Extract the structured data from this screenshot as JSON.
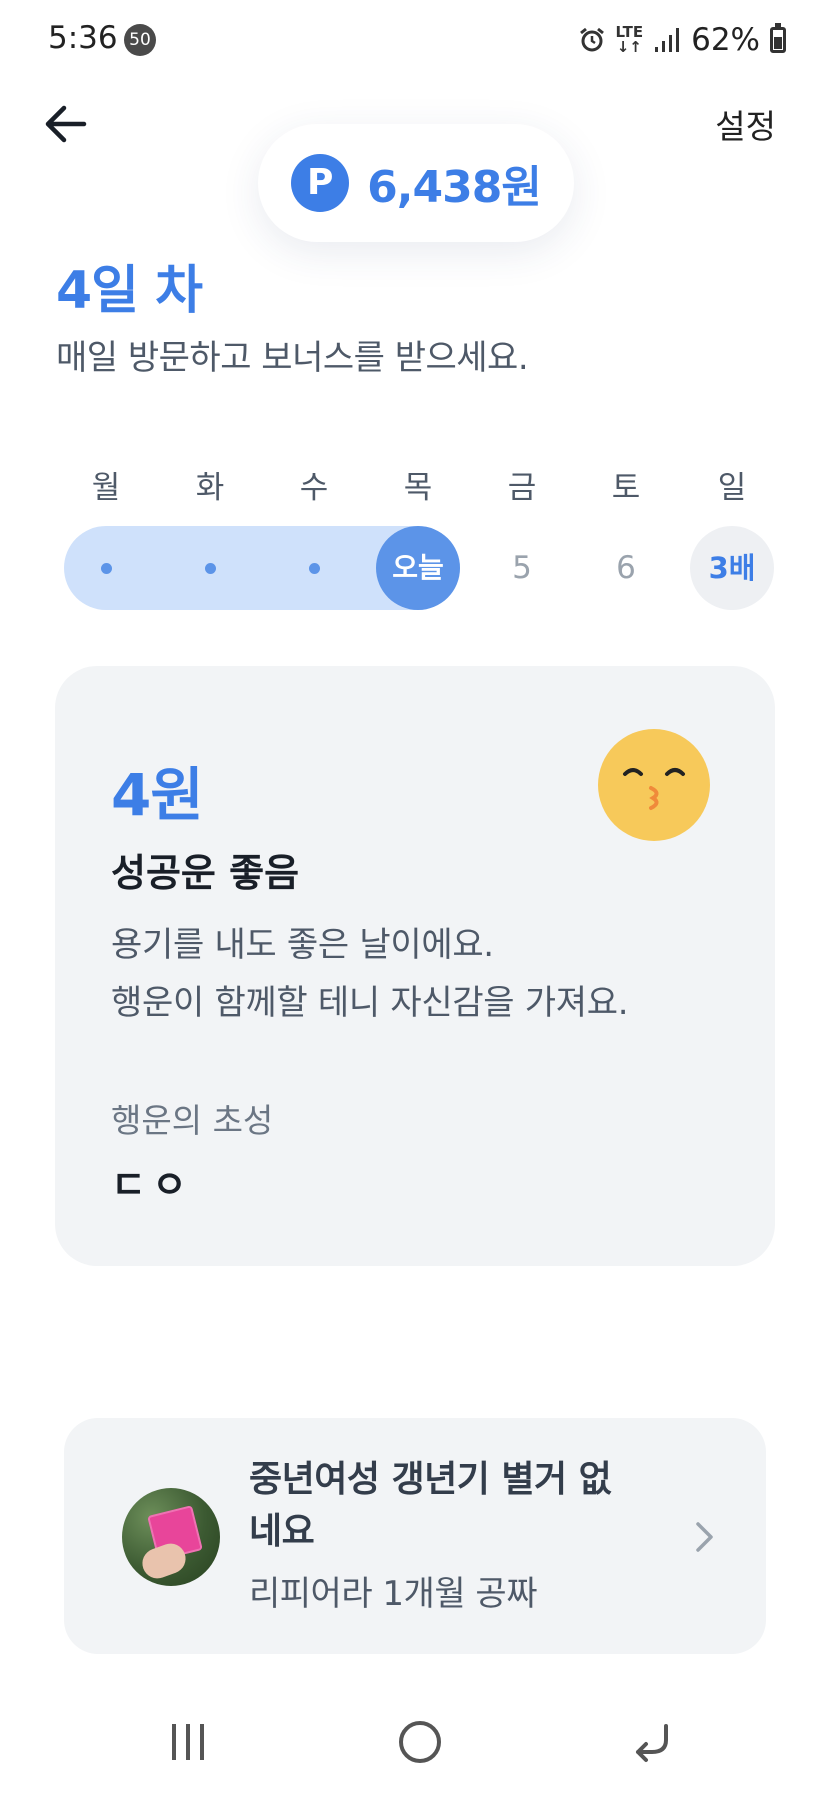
{
  "status_bar": {
    "time": "5:36",
    "notification_badge": "50",
    "network": "LTE",
    "battery": "62%"
  },
  "header": {
    "settings_label": "설정",
    "point_icon_letter": "P",
    "point_amount": "6,438원"
  },
  "attendance": {
    "day_title": "4일 차",
    "subtitle": "매일 방문하고 보너스를 받으세요.",
    "weekdays": [
      "월",
      "화",
      "수",
      "목",
      "금",
      "토",
      "일"
    ],
    "completed_days": 3,
    "today_label": "오늘",
    "future_days": [
      "5",
      "6"
    ],
    "bonus_label": "3배"
  },
  "fortune": {
    "amount": "4원",
    "title": "성공운 좋음",
    "description": [
      "용기를 내도 좋은 날이에요.",
      "행운이 함께할 테니 자신감을 가져요."
    ],
    "initials_label": "행운의 초성",
    "initials_value": "ㄷㅇ",
    "emoji": "kissing-face-icon"
  },
  "ad": {
    "title": "중년여성 갱년기 별거 없네요",
    "subtitle": "리피어라 1개월 공짜"
  },
  "colors": {
    "accent": "#3d7ee6",
    "progress_track": "#cfe1fb",
    "card_bg": "#f2f4f6"
  }
}
